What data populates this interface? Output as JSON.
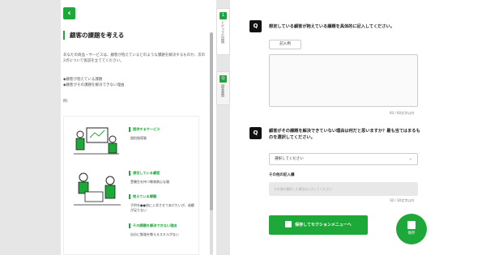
{
  "left": {
    "back_icon": "chevron-left-icon",
    "title": "顧客の課題を考える",
    "intro": "あなたの商品・サービスは、顧客が抱えているどのような課題を解決するものか、次の2点について仮説を立ててください。",
    "bullets": [
      "◆顧客が抱えている課題",
      "◆顧客がその課題を解決できない理由"
    ],
    "example_label": "例："
  },
  "example": {
    "row1": {
      "tag": "提供するサービス",
      "text": "個別指導塾"
    },
    "row2": [
      {
        "tag": "想定している顧客",
        "text": "受験生を持つ教育熱心な親"
      },
      {
        "tag": "抱えている課題",
        "text": "子供を●●校に入学させてあげたいが、成績が足りない"
      },
      {
        "tag": "その課題を解決できない理由",
        "text": "自分に勉強を教えるスキルがない"
      }
    ]
  },
  "tabs": [
    {
      "num": "1",
      "label": "トピックの説明"
    },
    {
      "num": "Q",
      "label": "回答質問"
    }
  ],
  "q1": {
    "icon": "Q",
    "text": "想定している顧客が抱えている課題を具体的に記入してください。",
    "example_button": "記入例",
    "counter": "60 / 60文字以内"
  },
  "q2": {
    "icon": "Q",
    "text": "顧客がその課題を解決できていない理由は何だと思いますか？最も当てはまるものを選択してください。",
    "select_value": "選択してください",
    "other_label": "その他の記入欄",
    "other_placeholder": "その他を選択した場合は入力してください",
    "counter": "30 / 30文字以内"
  },
  "actions": {
    "save_menu": "保存してセクションメニューへ",
    "save": "保存"
  },
  "colors": {
    "accent": "#1fa83a"
  }
}
